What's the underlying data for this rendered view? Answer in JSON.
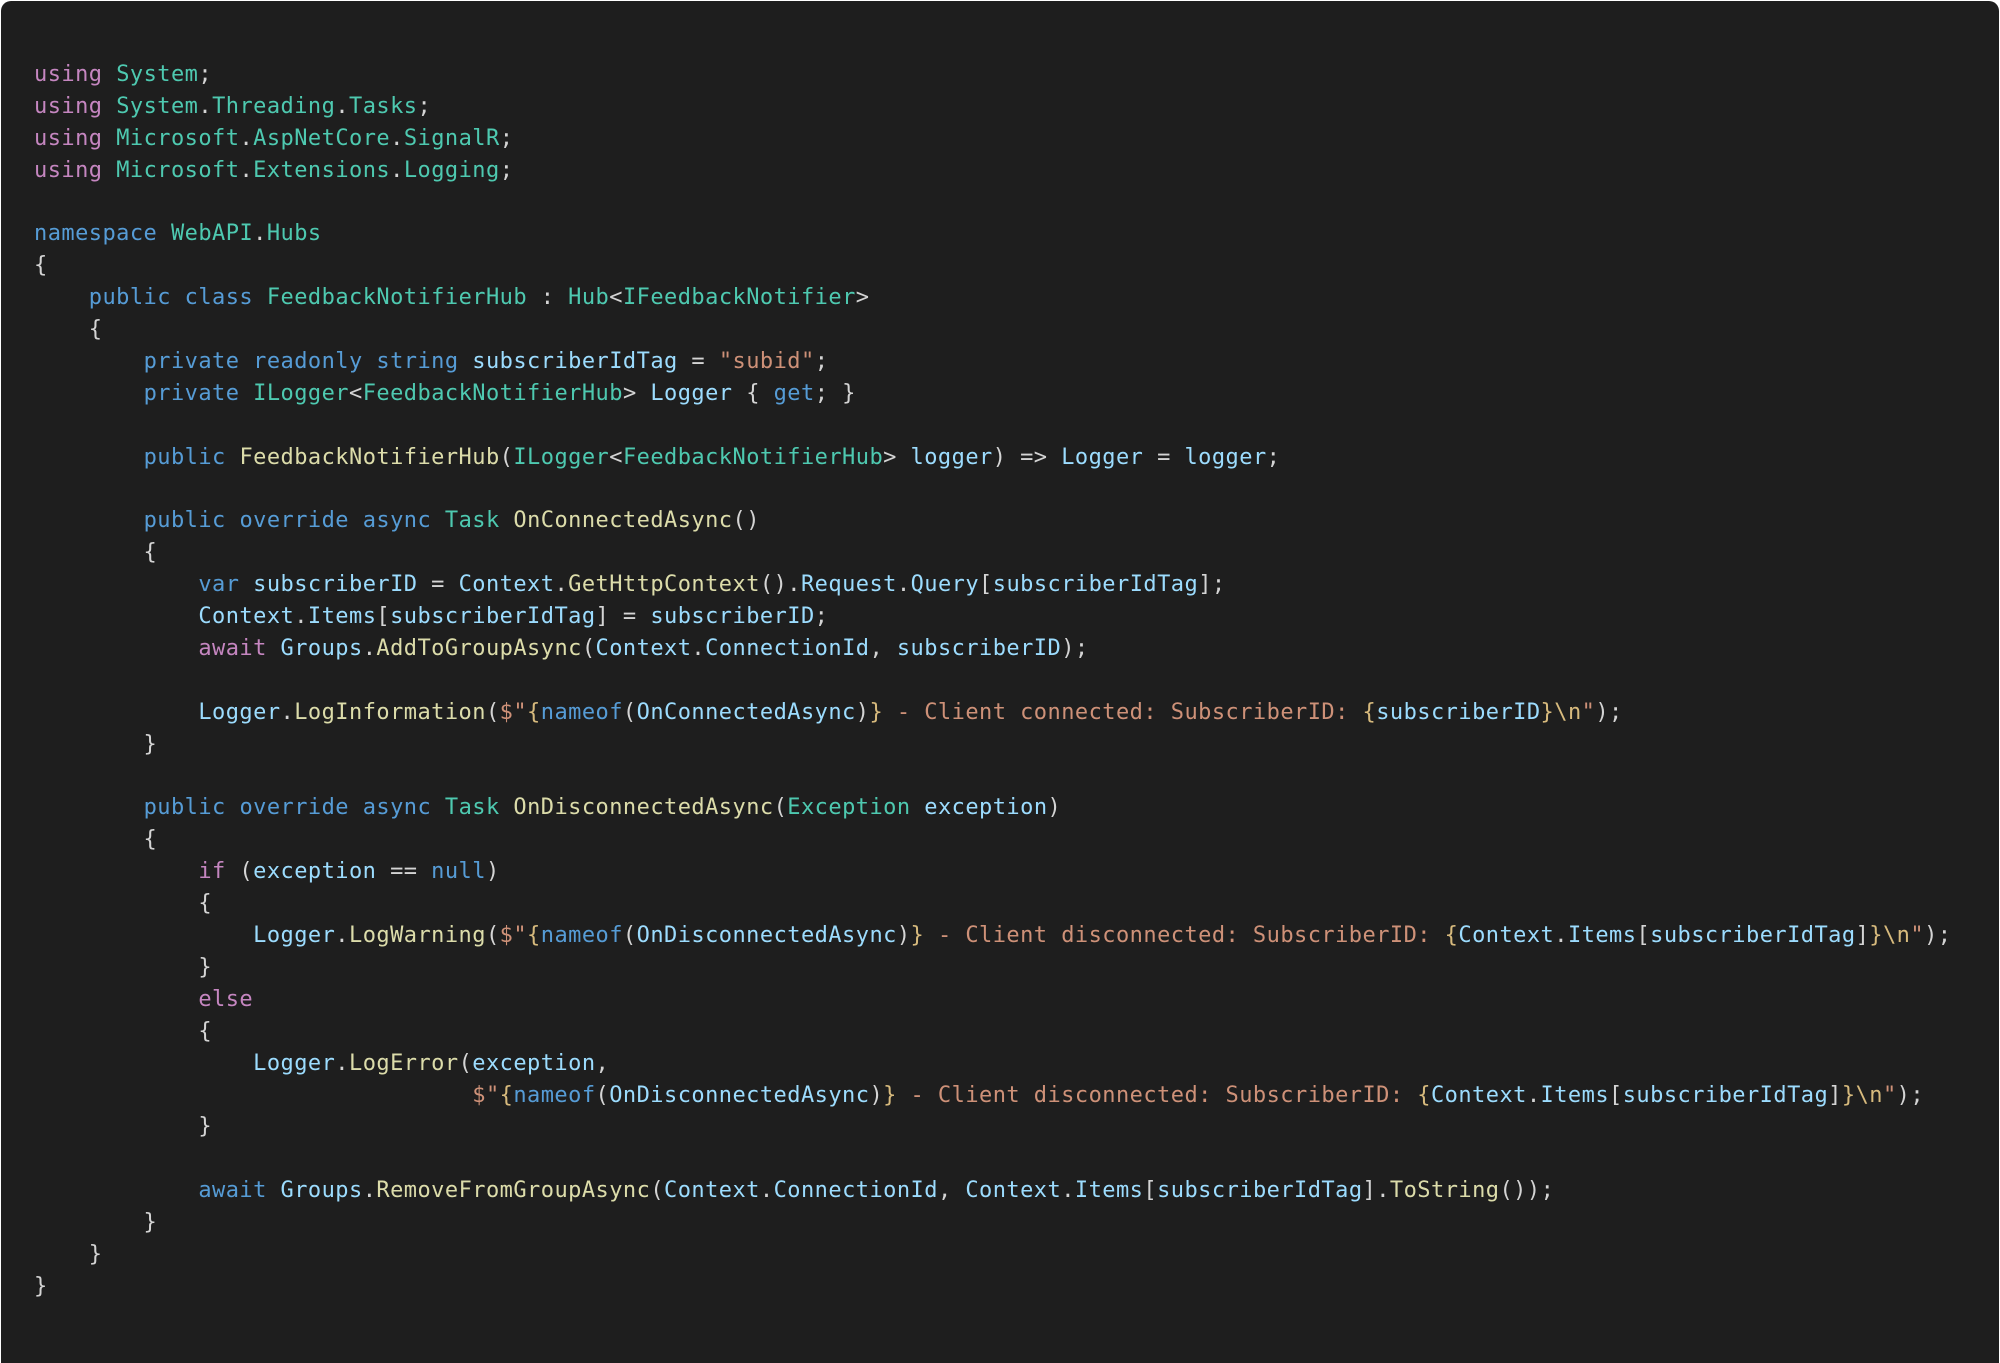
{
  "editor": {
    "language": "C#",
    "background_color": "#1e1e1e"
  },
  "code": {
    "lines": [
      [
        {
          "t": "using",
          "c": "ctl"
        },
        {
          "t": " ",
          "c": "txt"
        },
        {
          "t": "System",
          "c": "type"
        },
        {
          "t": ";",
          "c": "txt"
        }
      ],
      [
        {
          "t": "using",
          "c": "ctl"
        },
        {
          "t": " ",
          "c": "txt"
        },
        {
          "t": "System",
          "c": "type"
        },
        {
          "t": ".",
          "c": "txt"
        },
        {
          "t": "Threading",
          "c": "type"
        },
        {
          "t": ".",
          "c": "txt"
        },
        {
          "t": "Tasks",
          "c": "type"
        },
        {
          "t": ";",
          "c": "txt"
        }
      ],
      [
        {
          "t": "using",
          "c": "ctl"
        },
        {
          "t": " ",
          "c": "txt"
        },
        {
          "t": "Microsoft",
          "c": "type"
        },
        {
          "t": ".",
          "c": "txt"
        },
        {
          "t": "AspNetCore",
          "c": "type"
        },
        {
          "t": ".",
          "c": "txt"
        },
        {
          "t": "SignalR",
          "c": "type"
        },
        {
          "t": ";",
          "c": "txt"
        }
      ],
      [
        {
          "t": "using",
          "c": "ctl"
        },
        {
          "t": " ",
          "c": "txt"
        },
        {
          "t": "Microsoft",
          "c": "type"
        },
        {
          "t": ".",
          "c": "txt"
        },
        {
          "t": "Extensions",
          "c": "type"
        },
        {
          "t": ".",
          "c": "txt"
        },
        {
          "t": "Logging",
          "c": "type"
        },
        {
          "t": ";",
          "c": "txt"
        }
      ],
      [],
      [
        {
          "t": "namespace",
          "c": "kw"
        },
        {
          "t": " ",
          "c": "txt"
        },
        {
          "t": "WebAPI",
          "c": "type"
        },
        {
          "t": ".",
          "c": "txt"
        },
        {
          "t": "Hubs",
          "c": "type"
        }
      ],
      [
        {
          "t": "{",
          "c": "txt"
        }
      ],
      [
        {
          "t": "    ",
          "c": "txt"
        },
        {
          "t": "public",
          "c": "kw"
        },
        {
          "t": " ",
          "c": "txt"
        },
        {
          "t": "class",
          "c": "kw"
        },
        {
          "t": " ",
          "c": "txt"
        },
        {
          "t": "FeedbackNotifierHub",
          "c": "type"
        },
        {
          "t": " : ",
          "c": "txt"
        },
        {
          "t": "Hub",
          "c": "type"
        },
        {
          "t": "<",
          "c": "txt"
        },
        {
          "t": "IFeedbackNotifier",
          "c": "type"
        },
        {
          "t": ">",
          "c": "txt"
        }
      ],
      [
        {
          "t": "    {",
          "c": "txt"
        }
      ],
      [
        {
          "t": "        ",
          "c": "txt"
        },
        {
          "t": "private",
          "c": "kw"
        },
        {
          "t": " ",
          "c": "txt"
        },
        {
          "t": "readonly",
          "c": "kw"
        },
        {
          "t": " ",
          "c": "txt"
        },
        {
          "t": "string",
          "c": "kw"
        },
        {
          "t": " ",
          "c": "txt"
        },
        {
          "t": "subscriberIdTag",
          "c": "var"
        },
        {
          "t": " = ",
          "c": "txt"
        },
        {
          "t": "\"subid\"",
          "c": "str"
        },
        {
          "t": ";",
          "c": "txt"
        }
      ],
      [
        {
          "t": "        ",
          "c": "txt"
        },
        {
          "t": "private",
          "c": "kw"
        },
        {
          "t": " ",
          "c": "txt"
        },
        {
          "t": "ILogger",
          "c": "type"
        },
        {
          "t": "<",
          "c": "txt"
        },
        {
          "t": "FeedbackNotifierHub",
          "c": "type"
        },
        {
          "t": "> ",
          "c": "txt"
        },
        {
          "t": "Logger",
          "c": "var"
        },
        {
          "t": " { ",
          "c": "txt"
        },
        {
          "t": "get",
          "c": "kw"
        },
        {
          "t": "; }",
          "c": "txt"
        }
      ],
      [],
      [
        {
          "t": "        ",
          "c": "txt"
        },
        {
          "t": "public",
          "c": "kw"
        },
        {
          "t": " ",
          "c": "txt"
        },
        {
          "t": "FeedbackNotifierHub",
          "c": "fn"
        },
        {
          "t": "(",
          "c": "txt"
        },
        {
          "t": "ILogger",
          "c": "type"
        },
        {
          "t": "<",
          "c": "txt"
        },
        {
          "t": "FeedbackNotifierHub",
          "c": "type"
        },
        {
          "t": "> ",
          "c": "txt"
        },
        {
          "t": "logger",
          "c": "var"
        },
        {
          "t": ") => ",
          "c": "txt"
        },
        {
          "t": "Logger",
          "c": "var"
        },
        {
          "t": " = ",
          "c": "txt"
        },
        {
          "t": "logger",
          "c": "var"
        },
        {
          "t": ";",
          "c": "txt"
        }
      ],
      [],
      [
        {
          "t": "        ",
          "c": "txt"
        },
        {
          "t": "public",
          "c": "kw"
        },
        {
          "t": " ",
          "c": "txt"
        },
        {
          "t": "override",
          "c": "kw"
        },
        {
          "t": " ",
          "c": "txt"
        },
        {
          "t": "async",
          "c": "kw"
        },
        {
          "t": " ",
          "c": "txt"
        },
        {
          "t": "Task",
          "c": "type"
        },
        {
          "t": " ",
          "c": "txt"
        },
        {
          "t": "OnConnectedAsync",
          "c": "fn"
        },
        {
          "t": "()",
          "c": "txt"
        }
      ],
      [
        {
          "t": "        {",
          "c": "txt"
        }
      ],
      [
        {
          "t": "            ",
          "c": "txt"
        },
        {
          "t": "var",
          "c": "kw"
        },
        {
          "t": " ",
          "c": "txt"
        },
        {
          "t": "subscriberID",
          "c": "var"
        },
        {
          "t": " = ",
          "c": "txt"
        },
        {
          "t": "Context",
          "c": "var"
        },
        {
          "t": ".",
          "c": "txt"
        },
        {
          "t": "GetHttpContext",
          "c": "fn"
        },
        {
          "t": "().",
          "c": "txt"
        },
        {
          "t": "Request",
          "c": "var"
        },
        {
          "t": ".",
          "c": "txt"
        },
        {
          "t": "Query",
          "c": "var"
        },
        {
          "t": "[",
          "c": "txt"
        },
        {
          "t": "subscriberIdTag",
          "c": "var"
        },
        {
          "t": "];",
          "c": "txt"
        }
      ],
      [
        {
          "t": "            ",
          "c": "txt"
        },
        {
          "t": "Context",
          "c": "var"
        },
        {
          "t": ".",
          "c": "txt"
        },
        {
          "t": "Items",
          "c": "var"
        },
        {
          "t": "[",
          "c": "txt"
        },
        {
          "t": "subscriberIdTag",
          "c": "var"
        },
        {
          "t": "] = ",
          "c": "txt"
        },
        {
          "t": "subscriberID",
          "c": "var"
        },
        {
          "t": ";",
          "c": "txt"
        }
      ],
      [
        {
          "t": "            ",
          "c": "txt"
        },
        {
          "t": "await",
          "c": "ctl"
        },
        {
          "t": " ",
          "c": "txt"
        },
        {
          "t": "Groups",
          "c": "var"
        },
        {
          "t": ".",
          "c": "txt"
        },
        {
          "t": "AddToGroupAsync",
          "c": "fn"
        },
        {
          "t": "(",
          "c": "txt"
        },
        {
          "t": "Context",
          "c": "var"
        },
        {
          "t": ".",
          "c": "txt"
        },
        {
          "t": "ConnectionId",
          "c": "var"
        },
        {
          "t": ", ",
          "c": "txt"
        },
        {
          "t": "subscriberID",
          "c": "var"
        },
        {
          "t": ");",
          "c": "txt"
        }
      ],
      [],
      [
        {
          "t": "            ",
          "c": "txt"
        },
        {
          "t": "Logger",
          "c": "var"
        },
        {
          "t": ".",
          "c": "txt"
        },
        {
          "t": "LogInformation",
          "c": "fn"
        },
        {
          "t": "(",
          "c": "txt"
        },
        {
          "t": "$\"",
          "c": "str"
        },
        {
          "t": "{",
          "c": "esc"
        },
        {
          "t": "nameof",
          "c": "kw"
        },
        {
          "t": "(",
          "c": "txt"
        },
        {
          "t": "OnConnectedAsync",
          "c": "var"
        },
        {
          "t": ")",
          "c": "txt"
        },
        {
          "t": "}",
          "c": "esc"
        },
        {
          "t": " - Client connected: SubscriberID: ",
          "c": "str"
        },
        {
          "t": "{",
          "c": "esc"
        },
        {
          "t": "subscriberID",
          "c": "var"
        },
        {
          "t": "}",
          "c": "esc"
        },
        {
          "t": "\\n",
          "c": "esc"
        },
        {
          "t": "\"",
          "c": "str"
        },
        {
          "t": ");",
          "c": "txt"
        }
      ],
      [
        {
          "t": "        }",
          "c": "txt"
        }
      ],
      [],
      [
        {
          "t": "        ",
          "c": "txt"
        },
        {
          "t": "public",
          "c": "kw"
        },
        {
          "t": " ",
          "c": "txt"
        },
        {
          "t": "override",
          "c": "kw"
        },
        {
          "t": " ",
          "c": "txt"
        },
        {
          "t": "async",
          "c": "kw"
        },
        {
          "t": " ",
          "c": "txt"
        },
        {
          "t": "Task",
          "c": "type"
        },
        {
          "t": " ",
          "c": "txt"
        },
        {
          "t": "OnDisconnectedAsync",
          "c": "fn"
        },
        {
          "t": "(",
          "c": "txt"
        },
        {
          "t": "Exception",
          "c": "type"
        },
        {
          "t": " ",
          "c": "txt"
        },
        {
          "t": "exception",
          "c": "var"
        },
        {
          "t": ")",
          "c": "txt"
        }
      ],
      [
        {
          "t": "        {",
          "c": "txt"
        }
      ],
      [
        {
          "t": "            ",
          "c": "txt"
        },
        {
          "t": "if",
          "c": "ctl"
        },
        {
          "t": " (",
          "c": "txt"
        },
        {
          "t": "exception",
          "c": "var"
        },
        {
          "t": " == ",
          "c": "txt"
        },
        {
          "t": "null",
          "c": "kw"
        },
        {
          "t": ")",
          "c": "txt"
        }
      ],
      [
        {
          "t": "            {",
          "c": "txt"
        }
      ],
      [
        {
          "t": "                ",
          "c": "txt"
        },
        {
          "t": "Logger",
          "c": "var"
        },
        {
          "t": ".",
          "c": "txt"
        },
        {
          "t": "LogWarning",
          "c": "fn"
        },
        {
          "t": "(",
          "c": "txt"
        },
        {
          "t": "$\"",
          "c": "str"
        },
        {
          "t": "{",
          "c": "esc"
        },
        {
          "t": "nameof",
          "c": "kw"
        },
        {
          "t": "(",
          "c": "txt"
        },
        {
          "t": "OnDisconnectedAsync",
          "c": "var"
        },
        {
          "t": ")",
          "c": "txt"
        },
        {
          "t": "}",
          "c": "esc"
        },
        {
          "t": " - Client disconnected: SubscriberID: ",
          "c": "str"
        },
        {
          "t": "{",
          "c": "esc"
        },
        {
          "t": "Context",
          "c": "var"
        },
        {
          "t": ".",
          "c": "txt"
        },
        {
          "t": "Items",
          "c": "var"
        },
        {
          "t": "[",
          "c": "txt"
        },
        {
          "t": "subscriberIdTag",
          "c": "var"
        },
        {
          "t": "]",
          "c": "txt"
        },
        {
          "t": "}",
          "c": "esc"
        },
        {
          "t": "\\n",
          "c": "esc"
        },
        {
          "t": "\"",
          "c": "str"
        },
        {
          "t": ");",
          "c": "txt"
        }
      ],
      [
        {
          "t": "            }",
          "c": "txt"
        }
      ],
      [
        {
          "t": "            ",
          "c": "txt"
        },
        {
          "t": "else",
          "c": "ctl"
        }
      ],
      [
        {
          "t": "            {",
          "c": "txt"
        }
      ],
      [
        {
          "t": "                ",
          "c": "txt"
        },
        {
          "t": "Logger",
          "c": "var"
        },
        {
          "t": ".",
          "c": "txt"
        },
        {
          "t": "LogError",
          "c": "fn"
        },
        {
          "t": "(",
          "c": "txt"
        },
        {
          "t": "exception",
          "c": "var"
        },
        {
          "t": ",",
          "c": "txt"
        }
      ],
      [
        {
          "t": "                                ",
          "c": "txt"
        },
        {
          "t": "$\"",
          "c": "str"
        },
        {
          "t": "{",
          "c": "esc"
        },
        {
          "t": "nameof",
          "c": "kw"
        },
        {
          "t": "(",
          "c": "txt"
        },
        {
          "t": "OnDisconnectedAsync",
          "c": "var"
        },
        {
          "t": ")",
          "c": "txt"
        },
        {
          "t": "}",
          "c": "esc"
        },
        {
          "t": " - Client disconnected: SubscriberID: ",
          "c": "str"
        },
        {
          "t": "{",
          "c": "esc"
        },
        {
          "t": "Context",
          "c": "var"
        },
        {
          "t": ".",
          "c": "txt"
        },
        {
          "t": "Items",
          "c": "var"
        },
        {
          "t": "[",
          "c": "txt"
        },
        {
          "t": "subscriberIdTag",
          "c": "var"
        },
        {
          "t": "]",
          "c": "txt"
        },
        {
          "t": "}",
          "c": "esc"
        },
        {
          "t": "\\n",
          "c": "esc"
        },
        {
          "t": "\"",
          "c": "str"
        },
        {
          "t": ");",
          "c": "txt"
        }
      ],
      [
        {
          "t": "            }",
          "c": "txt"
        }
      ],
      [],
      [
        {
          "t": "            ",
          "c": "txt"
        },
        {
          "t": "await",
          "c": "kw"
        },
        {
          "t": " ",
          "c": "txt"
        },
        {
          "t": "Groups",
          "c": "var"
        },
        {
          "t": ".",
          "c": "txt"
        },
        {
          "t": "RemoveFromGroupAsync",
          "c": "fn"
        },
        {
          "t": "(",
          "c": "txt"
        },
        {
          "t": "Context",
          "c": "var"
        },
        {
          "t": ".",
          "c": "txt"
        },
        {
          "t": "ConnectionId",
          "c": "var"
        },
        {
          "t": ", ",
          "c": "txt"
        },
        {
          "t": "Context",
          "c": "var"
        },
        {
          "t": ".",
          "c": "txt"
        },
        {
          "t": "Items",
          "c": "var"
        },
        {
          "t": "[",
          "c": "txt"
        },
        {
          "t": "subscriberIdTag",
          "c": "var"
        },
        {
          "t": "].",
          "c": "txt"
        },
        {
          "t": "ToString",
          "c": "fn"
        },
        {
          "t": "());",
          "c": "txt"
        }
      ],
      [
        {
          "t": "        }",
          "c": "txt"
        }
      ],
      [
        {
          "t": "    }",
          "c": "txt"
        }
      ],
      [
        {
          "t": "}",
          "c": "txt"
        }
      ]
    ]
  }
}
